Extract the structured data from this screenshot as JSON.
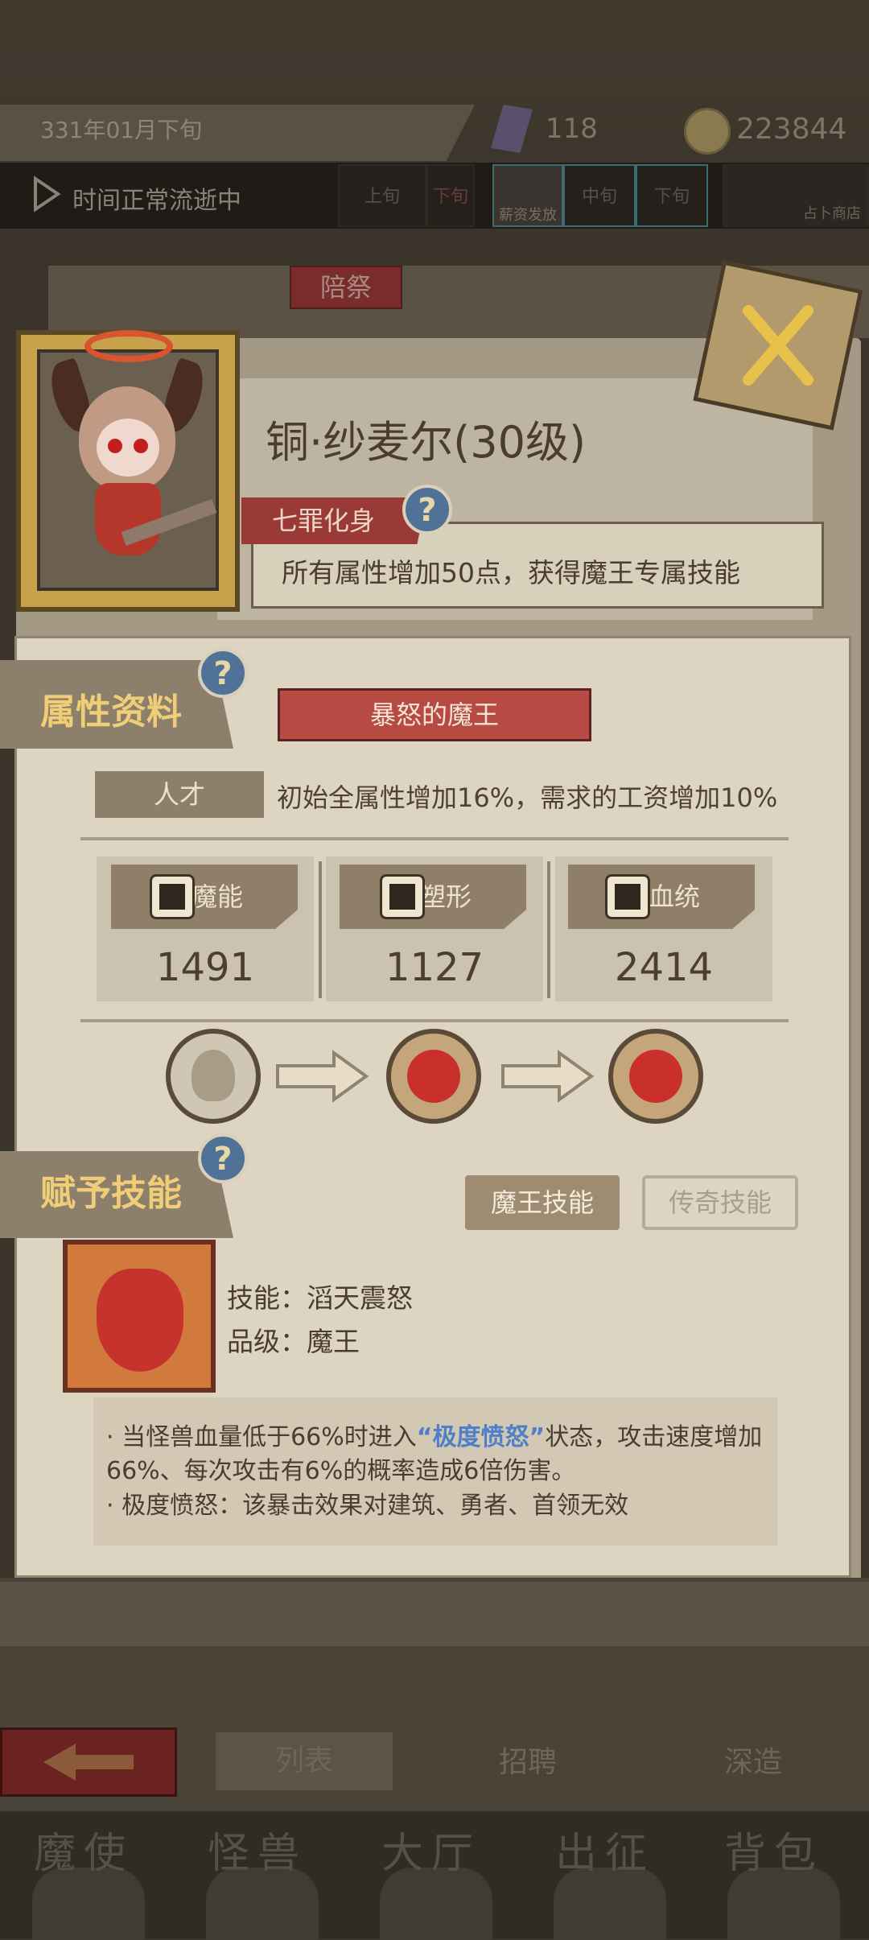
{
  "header": {
    "date": "331年01月下旬",
    "resource_1": "118",
    "resource_2": "223844",
    "time_status": "时间正常流逝中",
    "slots": {
      "slot_a": "上旬",
      "slot_b": "下旬",
      "slot_c_label": "薪资发放",
      "slot_d": "中旬",
      "slot_e": "下旬",
      "slot_f": "占卜商店"
    }
  },
  "tabs": {
    "active": "陪祭"
  },
  "character": {
    "name": "铜·纱麦尔(30级)",
    "title": "七罪化身",
    "title_desc": "所有属性增加50点，获得魔王专属技能"
  },
  "attributes": {
    "section_title": "属性资料",
    "race": "暴怒的魔王",
    "talent_label": "人才",
    "talent_desc": "初始全属性增加16%，需求的工资增加10%",
    "stats": [
      {
        "label": "魔能",
        "value": "1491",
        "icon": "demon-energy-icon"
      },
      {
        "label": "塑形",
        "value": "1127",
        "icon": "body-shape-icon"
      },
      {
        "label": "血统",
        "value": "2414",
        "icon": "bloodline-icon"
      }
    ]
  },
  "skills": {
    "section_title": "赋予技能",
    "btn_king": "魔王技能",
    "btn_legend": "传奇技能",
    "skill_name": "技能：滔天震怒",
    "skill_grade": "品级：魔王",
    "desc_line1_prefix": "·    当怪兽血量低于66%时进入",
    "desc_highlight": "“极度愤怒”",
    "desc_line1_suffix": "状态，攻击速度增加66%、每次攻击有6%的概率造成6倍伤害。",
    "desc_line2": "·    极度愤怒：该暴击效果对建筑、勇者、首领无效"
  },
  "subnav": {
    "list": "列表",
    "recruit": "招聘",
    "deep": "深造"
  },
  "bottom_nav": [
    "魔使",
    "怪兽",
    "大厅",
    "出征",
    "背包"
  ],
  "colors": {
    "accent_red": "#9a3a37",
    "highlight_blue": "#4f7fc7",
    "title_gold": "#f0ce77"
  }
}
